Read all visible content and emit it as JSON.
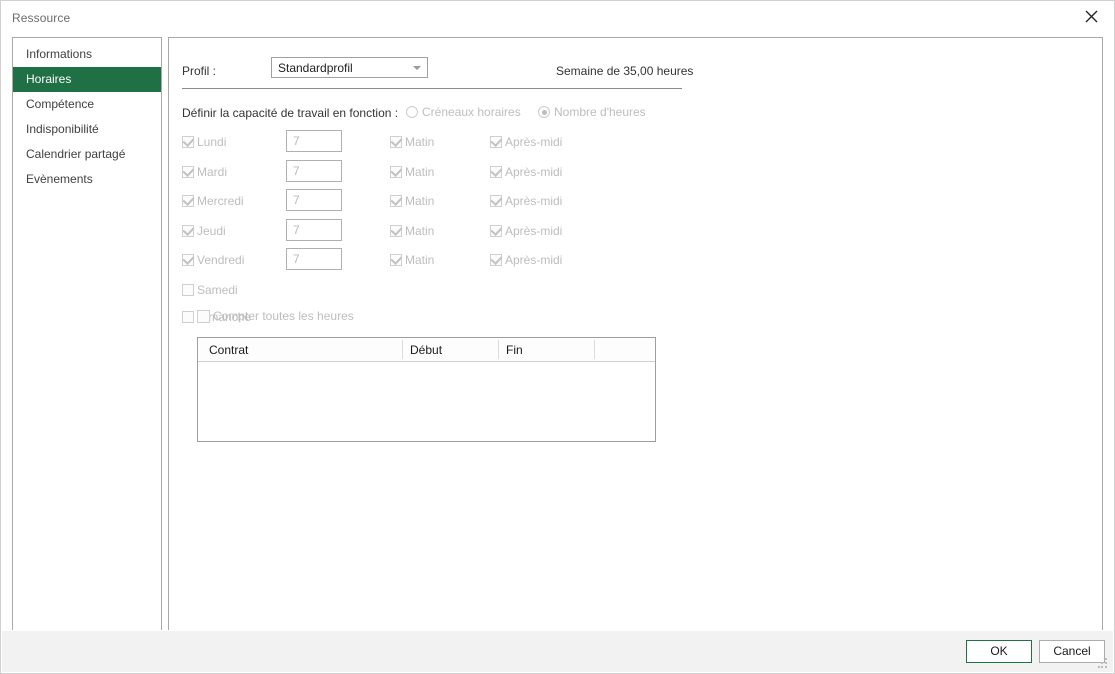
{
  "window": {
    "title": "Ressource",
    "close_icon": "close-icon"
  },
  "sidebar": {
    "items": [
      {
        "label": "Informations",
        "selected": false
      },
      {
        "label": "Horaires",
        "selected": true
      },
      {
        "label": "Compétence",
        "selected": false
      },
      {
        "label": "Indisponibilité",
        "selected": false
      },
      {
        "label": "Calendrier partagé",
        "selected": false
      },
      {
        "label": "Evènements",
        "selected": false
      }
    ]
  },
  "content": {
    "profil_label": "Profil :",
    "profil_value": "Standardprofil",
    "profil_options": [
      "Standardprofil"
    ],
    "week_total": "Semaine de 35,00 heures",
    "capacity_label": "Définir la capacité de travail en fonction :",
    "capacity_options": [
      {
        "label": "Créneaux horaires",
        "selected": false
      },
      {
        "label": "Nombre d'heures",
        "selected": true
      }
    ],
    "morning_label": "Matin",
    "afternoon_label": "Après-midi",
    "days": [
      {
        "label": "Lundi",
        "checked": true,
        "hours": "7",
        "morning": true,
        "afternoon": true
      },
      {
        "label": "Mardi",
        "checked": true,
        "hours": "7",
        "morning": true,
        "afternoon": true
      },
      {
        "label": "Mercredi",
        "checked": true,
        "hours": "7",
        "morning": true,
        "afternoon": true
      },
      {
        "label": "Jeudi",
        "checked": true,
        "hours": "7",
        "morning": true,
        "afternoon": true
      },
      {
        "label": "Vendredi",
        "checked": true,
        "hours": "7",
        "morning": true,
        "afternoon": true
      }
    ],
    "weekend": [
      {
        "label": "Samedi",
        "checked": false
      },
      {
        "label": "Dimanche",
        "checked": false
      }
    ],
    "count_all": {
      "label": "Compter toutes les heures",
      "checked": false
    },
    "table": {
      "columns": [
        "Contrat",
        "Début",
        "Fin",
        ""
      ],
      "rows": []
    }
  },
  "footer": {
    "ok_label": "OK",
    "cancel_label": "Cancel"
  }
}
